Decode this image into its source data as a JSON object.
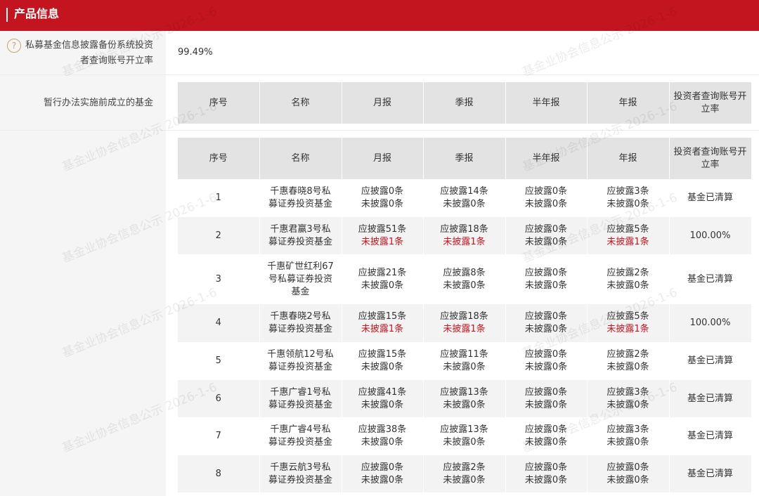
{
  "section": {
    "title": "产品信息"
  },
  "open_rate": {
    "label": "私募基金信息披露备份系统投资者查询账号开立率",
    "value": "99.49%"
  },
  "pre_funds": {
    "label": "暂行办法实施前成立的基金"
  },
  "columns": [
    "序号",
    "名称",
    "月报",
    "季报",
    "半年报",
    "年报",
    "投资者查询账号开立率"
  ],
  "rows": [
    {
      "no": "1",
      "name": "千惠春晓8号私募证券投资基金",
      "monthly": [
        "应披露0条",
        "未披露0条"
      ],
      "quarterly": [
        "应披露14条",
        "未披露0条"
      ],
      "semiannual": [
        "应披露0条",
        "未披露0条"
      ],
      "annual": [
        "应披露3条",
        "未披露0条"
      ],
      "rate": "基金已清算"
    },
    {
      "no": "2",
      "name": "千惠君赢3号私募证券投资基金",
      "monthly": [
        "应披露51条",
        "未披露1条"
      ],
      "quarterly": [
        "应披露18条",
        "未披露1条"
      ],
      "semiannual": [
        "应披露0条",
        "未披露0条"
      ],
      "annual": [
        "应披露5条",
        "未披露1条"
      ],
      "rate": "100.00%"
    },
    {
      "no": "3",
      "name": "千惠矿世红利67号私募证券投资基金",
      "monthly": [
        "应披露21条",
        "未披露0条"
      ],
      "quarterly": [
        "应披露8条",
        "未披露0条"
      ],
      "semiannual": [
        "应披露0条",
        "未披露0条"
      ],
      "annual": [
        "应披露2条",
        "未披露0条"
      ],
      "rate": "基金已清算"
    },
    {
      "no": "4",
      "name": "千惠春晓2号私募证券投资基金",
      "monthly": [
        "应披露15条",
        "未披露1条"
      ],
      "quarterly": [
        "应披露18条",
        "未披露1条"
      ],
      "semiannual": [
        "应披露0条",
        "未披露0条"
      ],
      "annual": [
        "应披露5条",
        "未披露1条"
      ],
      "rate": "100.00%"
    },
    {
      "no": "5",
      "name": "千惠领航12号私募证券投资基金",
      "monthly": [
        "应披露15条",
        "未披露0条"
      ],
      "quarterly": [
        "应披露11条",
        "未披露0条"
      ],
      "semiannual": [
        "应披露0条",
        "未披露0条"
      ],
      "annual": [
        "应披露2条",
        "未披露0条"
      ],
      "rate": "基金已清算"
    },
    {
      "no": "6",
      "name": "千惠广睿1号私募证券投资基金",
      "monthly": [
        "应披露41条",
        "未披露0条"
      ],
      "quarterly": [
        "应披露13条",
        "未披露0条"
      ],
      "semiannual": [
        "应披露0条",
        "未披露0条"
      ],
      "annual": [
        "应披露3条",
        "未披露0条"
      ],
      "rate": "基金已清算"
    },
    {
      "no": "7",
      "name": "千惠广睿4号私募证券投资基金",
      "monthly": [
        "应披露38条",
        "未披露0条"
      ],
      "quarterly": [
        "应披露13条",
        "未披露0条"
      ],
      "semiannual": [
        "应披露0条",
        "未披露0条"
      ],
      "annual": [
        "应披露3条",
        "未披露0条"
      ],
      "rate": "基金已清算"
    },
    {
      "no": "8",
      "name": "千惠云航3号私募证券投资基金",
      "monthly": [
        "应披露0条",
        "未披露0条"
      ],
      "quarterly": [
        "应披露2条",
        "未披露0条"
      ],
      "semiannual": [
        "应披露0条",
        "未披露0条"
      ],
      "annual": [
        "应披露0条",
        "未披露0条"
      ],
      "rate": "基金已清算"
    }
  ],
  "watermark": "基金业协会信息公示 2026-1-6",
  "colors": {
    "brand": "#c3151f",
    "header_cell": "#e3e3e3",
    "alt_row": "#f3f3f3",
    "help_icon": "#c9a26b"
  }
}
